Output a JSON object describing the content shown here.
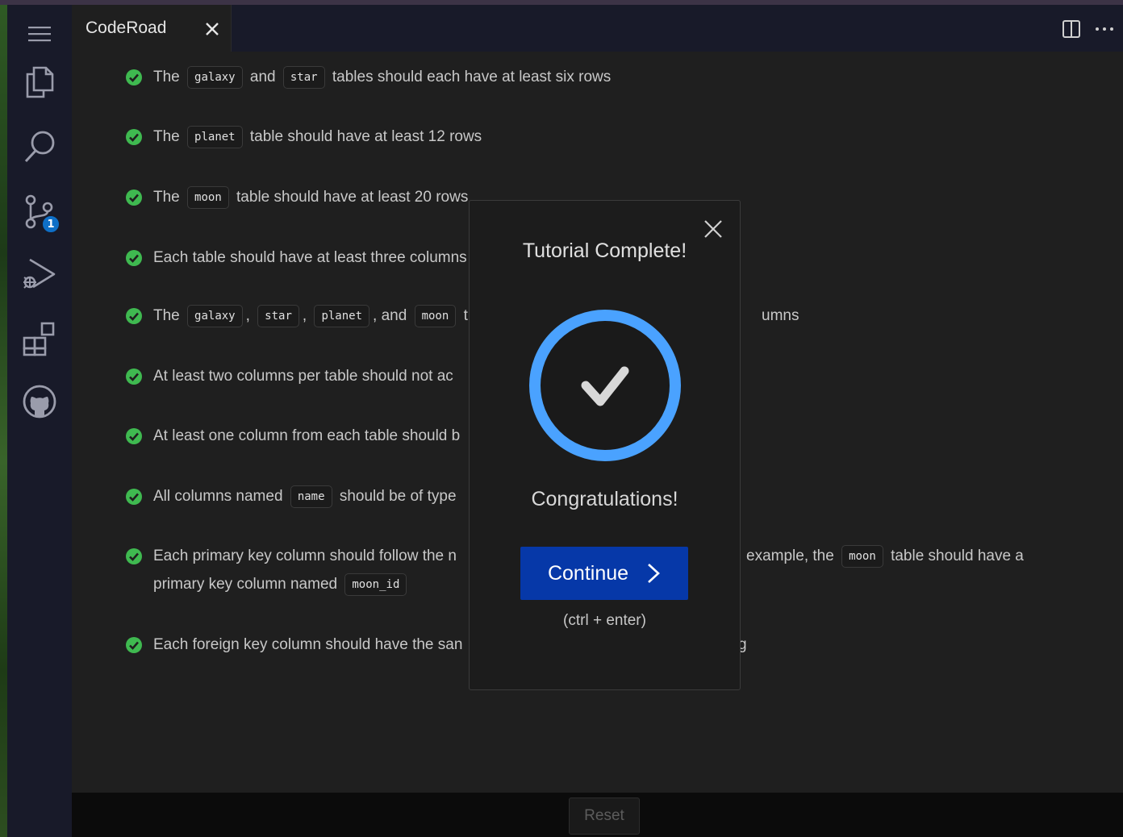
{
  "window": {
    "tab_title": "CodeRoad"
  },
  "activity_bar": {
    "items": [
      {
        "icon": "menu-icon"
      },
      {
        "icon": "explorer-files-icon"
      },
      {
        "icon": "search-icon"
      },
      {
        "icon": "source-control-icon",
        "badge": "1"
      },
      {
        "icon": "run-debug-icon"
      },
      {
        "icon": "extensions-icon"
      },
      {
        "icon": "github-icon"
      }
    ]
  },
  "colors": {
    "check_green": "#3fb950",
    "ring_blue": "#4aa2ff",
    "continue_button": "#0638a8",
    "badge_blue": "#0e6fc7"
  },
  "tests": [
    {
      "parts": [
        "The",
        "galaxy",
        "and",
        "star",
        "tables should each have at least six rows"
      ]
    },
    {
      "parts": [
        "The",
        "planet",
        "table should have at least 12 rows"
      ]
    },
    {
      "parts": [
        "The",
        "moon",
        "table should have at least 20 rows"
      ]
    },
    {
      "parts": [
        "Each table should have at least three columns"
      ]
    },
    {
      "parts": [
        "The",
        "galaxy",
        ",",
        "star",
        ",",
        "planet",
        ", and",
        "moon",
        "t",
        "umns"
      ]
    },
    {
      "parts": [
        "At least two columns per table should not ac"
      ]
    },
    {
      "parts": [
        "At least one column from each table should b"
      ]
    },
    {
      "parts": [
        "All columns named",
        "name",
        "should be of type"
      ]
    },
    {
      "parts": [
        "Each primary key column should follow the n",
        "example, the",
        "moon",
        "table should have a",
        "primary key column named",
        "moon_id"
      ]
    },
    {
      "parts": [
        "Each foreign key column should have the san",
        "g"
      ]
    }
  ],
  "modal": {
    "title": "Tutorial Complete!",
    "message": "Congratulations!",
    "continue_label": "Continue",
    "shortcut_hint": "(ctrl + enter)"
  },
  "footer": {
    "reset_label": "Reset"
  }
}
